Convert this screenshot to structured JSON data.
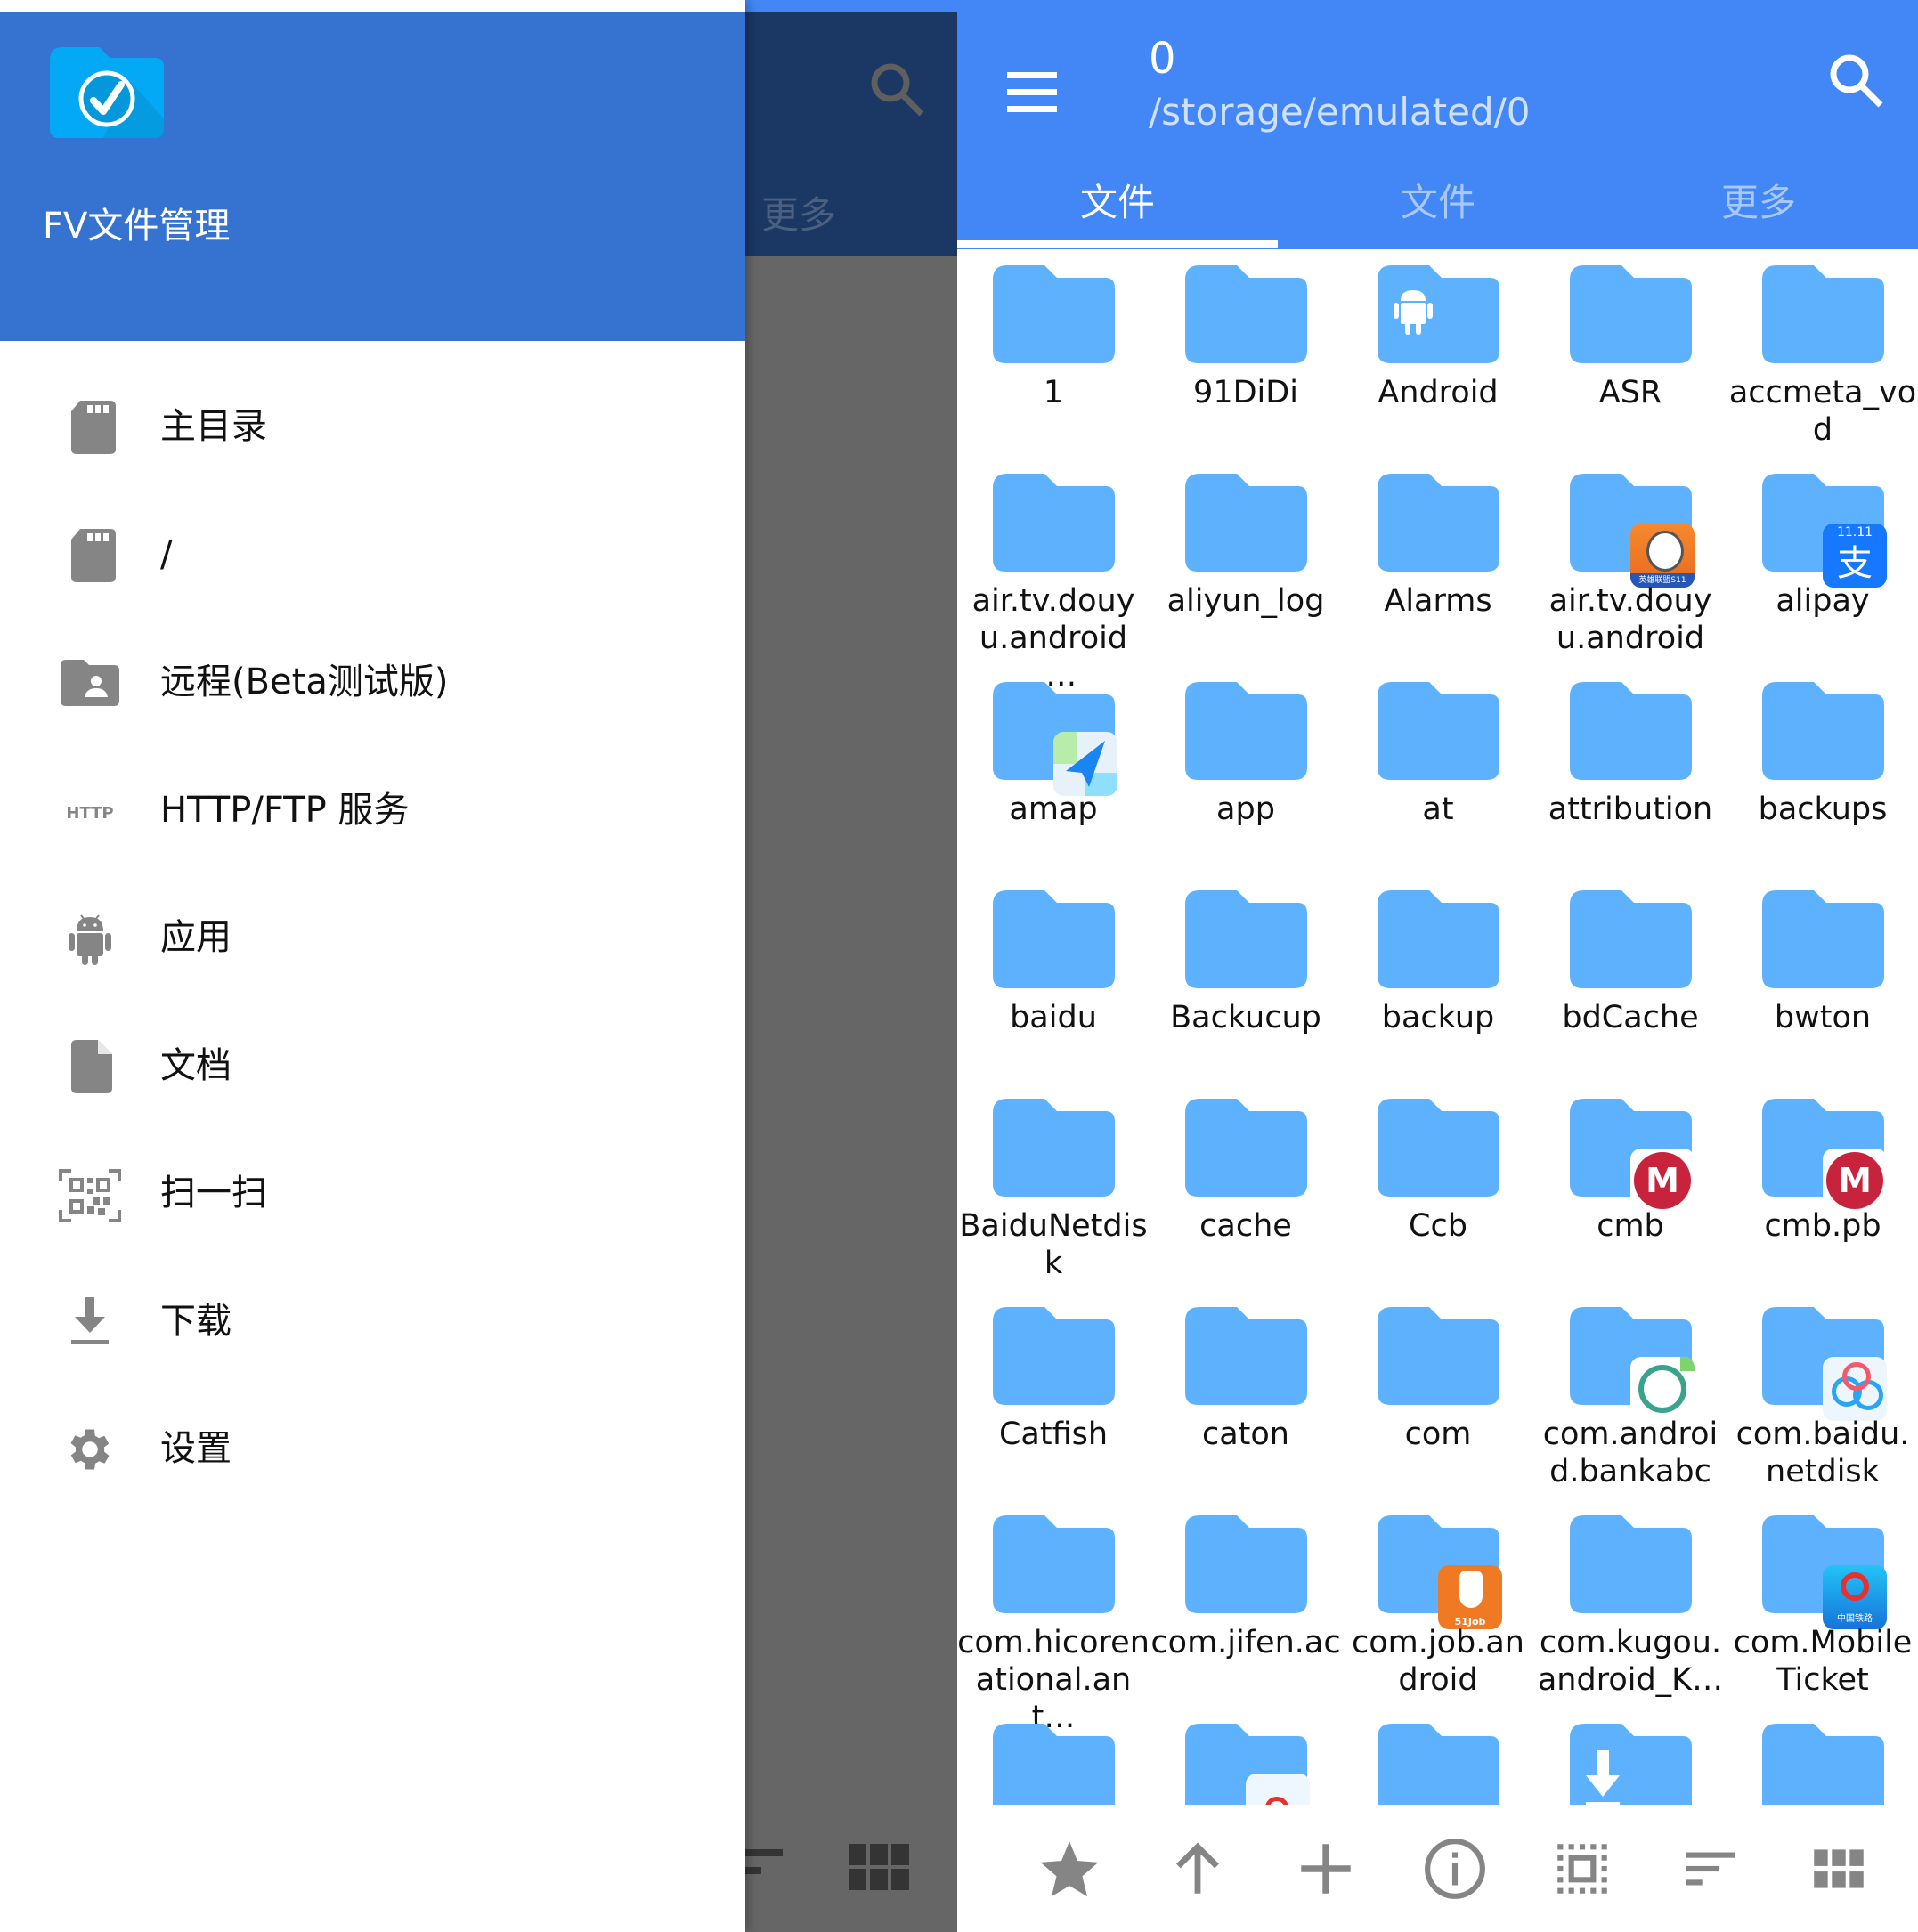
{
  "drawer": {
    "app_title": "FV文件管理",
    "logo_icon": "folder-check-logo",
    "items": [
      {
        "label": "主目录",
        "icon": "sd-card-icon"
      },
      {
        "label": "/",
        "icon": "sd-card-icon"
      },
      {
        "label": "远程(Beta测试版)",
        "icon": "shared-folder-icon"
      },
      {
        "label": "HTTP/FTP 服务",
        "icon": "http-icon",
        "icon_text": "HTTP"
      },
      {
        "label": "应用",
        "icon": "android-icon"
      },
      {
        "label": "文档",
        "icon": "document-icon"
      },
      {
        "label": "扫一扫",
        "icon": "qr-scan-icon"
      },
      {
        "label": "下载",
        "icon": "download-icon"
      },
      {
        "label": "设置",
        "icon": "gear-icon"
      }
    ]
  },
  "overlay": {
    "tab_label": "更多"
  },
  "appbar": {
    "title": "0",
    "path": "/storage/emulated/0",
    "menu_icon": "hamburger-menu-icon",
    "search_icon": "search-icon"
  },
  "tabs": [
    {
      "label": "文件",
      "active": true
    },
    {
      "label": "文件",
      "active": false
    },
    {
      "label": "更多",
      "active": false
    }
  ],
  "files": [
    {
      "name": "1"
    },
    {
      "name": "91DiDi"
    },
    {
      "name": "Android",
      "badge": "android-glyph"
    },
    {
      "name": "ASR"
    },
    {
      "name": "accmeta_vod"
    },
    {
      "name": "air.tv.douyu.android_…"
    },
    {
      "name": "aliyun_log"
    },
    {
      "name": "Alarms"
    },
    {
      "name": "air.tv.douyu.android",
      "badge": "douyu-app-icon",
      "badge_text": "英雄联盟S11"
    },
    {
      "name": "alipay",
      "badge": "alipay-app-icon",
      "badge_text": "11.11"
    },
    {
      "name": "amap",
      "badge": "amap-app-icon"
    },
    {
      "name": "app"
    },
    {
      "name": "at"
    },
    {
      "name": "attribution"
    },
    {
      "name": "backups"
    },
    {
      "name": "baidu"
    },
    {
      "name": "Backucup"
    },
    {
      "name": "backup"
    },
    {
      "name": "bdCache"
    },
    {
      "name": "bwton"
    },
    {
      "name": "BaiduNetdisk"
    },
    {
      "name": "cache"
    },
    {
      "name": "Ccb"
    },
    {
      "name": "cmb",
      "badge": "cmb-app-icon"
    },
    {
      "name": "cmb.pb",
      "badge": "cmb-app-icon"
    },
    {
      "name": "Catfish"
    },
    {
      "name": "caton"
    },
    {
      "name": "com"
    },
    {
      "name": "com.android.bankabc",
      "badge": "abc-bank-app-icon"
    },
    {
      "name": "com.baidu.netdisk",
      "badge": "baidu-netdisk-app-icon"
    },
    {
      "name": "com.hicorenational.ant…"
    },
    {
      "name": "com.jifen.ac"
    },
    {
      "name": "com.job.android",
      "badge": "51job-app-icon",
      "badge_text": "51Job"
    },
    {
      "name": "com.kugou.android_K…"
    },
    {
      "name": "com.MobileTicket",
      "badge": "railway-app-icon",
      "badge_text": "中国铁路"
    },
    {
      "name": ""
    },
    {
      "name": "",
      "badge": "weibo-app-icon"
    },
    {
      "name": ""
    },
    {
      "name": "",
      "badge": "download-glyph"
    },
    {
      "name": ""
    }
  ],
  "bottom_toolbar": [
    {
      "name": "favorites",
      "icon": "star-icon"
    },
    {
      "name": "parent-directory",
      "icon": "arrow-up-icon"
    },
    {
      "name": "new",
      "icon": "plus-icon"
    },
    {
      "name": "info",
      "icon": "info-icon"
    },
    {
      "name": "select",
      "icon": "select-all-icon"
    },
    {
      "name": "sort",
      "icon": "sort-icon"
    },
    {
      "name": "view-mode",
      "icon": "grid-view-icon"
    }
  ],
  "colors": {
    "app_bar": "#4287f5",
    "drawer_header": "#3673d1",
    "folder": "#5eb2fd",
    "icon_gray": "#858585"
  }
}
